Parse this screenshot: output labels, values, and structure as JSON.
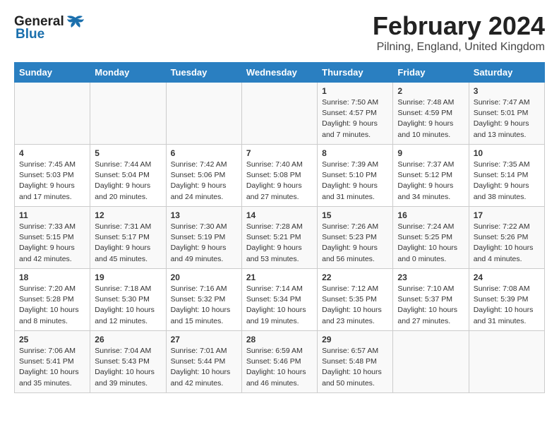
{
  "header": {
    "title": "February 2024",
    "subtitle": "Pilning, England, United Kingdom",
    "logo_general": "General",
    "logo_blue": "Blue"
  },
  "days_of_week": [
    "Sunday",
    "Monday",
    "Tuesday",
    "Wednesday",
    "Thursday",
    "Friday",
    "Saturday"
  ],
  "weeks": [
    [
      {
        "day": "",
        "info": ""
      },
      {
        "day": "",
        "info": ""
      },
      {
        "day": "",
        "info": ""
      },
      {
        "day": "",
        "info": ""
      },
      {
        "day": "1",
        "info": "Sunrise: 7:50 AM\nSunset: 4:57 PM\nDaylight: 9 hours\nand 7 minutes."
      },
      {
        "day": "2",
        "info": "Sunrise: 7:48 AM\nSunset: 4:59 PM\nDaylight: 9 hours\nand 10 minutes."
      },
      {
        "day": "3",
        "info": "Sunrise: 7:47 AM\nSunset: 5:01 PM\nDaylight: 9 hours\nand 13 minutes."
      }
    ],
    [
      {
        "day": "4",
        "info": "Sunrise: 7:45 AM\nSunset: 5:03 PM\nDaylight: 9 hours\nand 17 minutes."
      },
      {
        "day": "5",
        "info": "Sunrise: 7:44 AM\nSunset: 5:04 PM\nDaylight: 9 hours\nand 20 minutes."
      },
      {
        "day": "6",
        "info": "Sunrise: 7:42 AM\nSunset: 5:06 PM\nDaylight: 9 hours\nand 24 minutes."
      },
      {
        "day": "7",
        "info": "Sunrise: 7:40 AM\nSunset: 5:08 PM\nDaylight: 9 hours\nand 27 minutes."
      },
      {
        "day": "8",
        "info": "Sunrise: 7:39 AM\nSunset: 5:10 PM\nDaylight: 9 hours\nand 31 minutes."
      },
      {
        "day": "9",
        "info": "Sunrise: 7:37 AM\nSunset: 5:12 PM\nDaylight: 9 hours\nand 34 minutes."
      },
      {
        "day": "10",
        "info": "Sunrise: 7:35 AM\nSunset: 5:14 PM\nDaylight: 9 hours\nand 38 minutes."
      }
    ],
    [
      {
        "day": "11",
        "info": "Sunrise: 7:33 AM\nSunset: 5:15 PM\nDaylight: 9 hours\nand 42 minutes."
      },
      {
        "day": "12",
        "info": "Sunrise: 7:31 AM\nSunset: 5:17 PM\nDaylight: 9 hours\nand 45 minutes."
      },
      {
        "day": "13",
        "info": "Sunrise: 7:30 AM\nSunset: 5:19 PM\nDaylight: 9 hours\nand 49 minutes."
      },
      {
        "day": "14",
        "info": "Sunrise: 7:28 AM\nSunset: 5:21 PM\nDaylight: 9 hours\nand 53 minutes."
      },
      {
        "day": "15",
        "info": "Sunrise: 7:26 AM\nSunset: 5:23 PM\nDaylight: 9 hours\nand 56 minutes."
      },
      {
        "day": "16",
        "info": "Sunrise: 7:24 AM\nSunset: 5:25 PM\nDaylight: 10 hours\nand 0 minutes."
      },
      {
        "day": "17",
        "info": "Sunrise: 7:22 AM\nSunset: 5:26 PM\nDaylight: 10 hours\nand 4 minutes."
      }
    ],
    [
      {
        "day": "18",
        "info": "Sunrise: 7:20 AM\nSunset: 5:28 PM\nDaylight: 10 hours\nand 8 minutes."
      },
      {
        "day": "19",
        "info": "Sunrise: 7:18 AM\nSunset: 5:30 PM\nDaylight: 10 hours\nand 12 minutes."
      },
      {
        "day": "20",
        "info": "Sunrise: 7:16 AM\nSunset: 5:32 PM\nDaylight: 10 hours\nand 15 minutes."
      },
      {
        "day": "21",
        "info": "Sunrise: 7:14 AM\nSunset: 5:34 PM\nDaylight: 10 hours\nand 19 minutes."
      },
      {
        "day": "22",
        "info": "Sunrise: 7:12 AM\nSunset: 5:35 PM\nDaylight: 10 hours\nand 23 minutes."
      },
      {
        "day": "23",
        "info": "Sunrise: 7:10 AM\nSunset: 5:37 PM\nDaylight: 10 hours\nand 27 minutes."
      },
      {
        "day": "24",
        "info": "Sunrise: 7:08 AM\nSunset: 5:39 PM\nDaylight: 10 hours\nand 31 minutes."
      }
    ],
    [
      {
        "day": "25",
        "info": "Sunrise: 7:06 AM\nSunset: 5:41 PM\nDaylight: 10 hours\nand 35 minutes."
      },
      {
        "day": "26",
        "info": "Sunrise: 7:04 AM\nSunset: 5:43 PM\nDaylight: 10 hours\nand 39 minutes."
      },
      {
        "day": "27",
        "info": "Sunrise: 7:01 AM\nSunset: 5:44 PM\nDaylight: 10 hours\nand 42 minutes."
      },
      {
        "day": "28",
        "info": "Sunrise: 6:59 AM\nSunset: 5:46 PM\nDaylight: 10 hours\nand 46 minutes."
      },
      {
        "day": "29",
        "info": "Sunrise: 6:57 AM\nSunset: 5:48 PM\nDaylight: 10 hours\nand 50 minutes."
      },
      {
        "day": "",
        "info": ""
      },
      {
        "day": "",
        "info": ""
      }
    ]
  ]
}
